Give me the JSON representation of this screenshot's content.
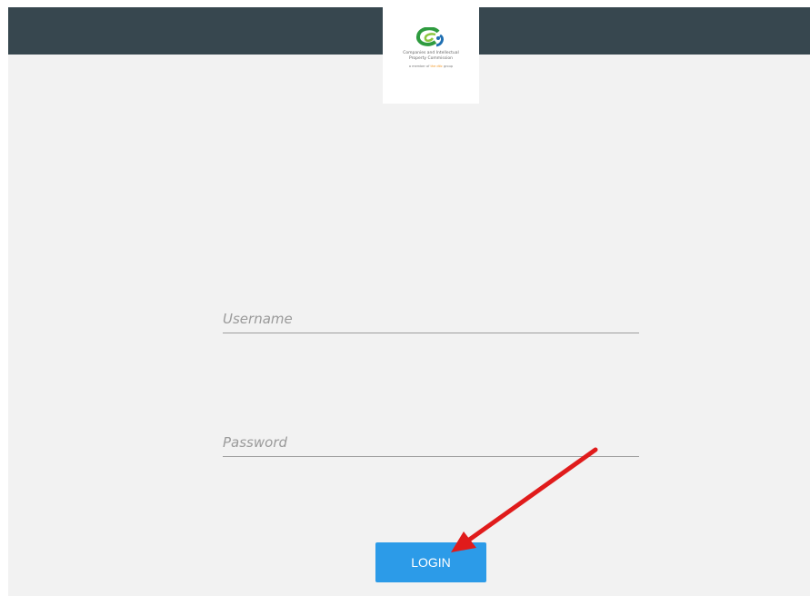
{
  "header": {
    "logo": {
      "icon": "cipc-logo-icon",
      "line_1": "Companies and Intellectual",
      "line_2": "Property Commission",
      "tagline_prefix": "a member of ",
      "tagline_brand": "the dtic",
      "tagline_suffix": " group",
      "brand_colors": [
        "#2e9b3f",
        "#1f6fb2",
        "#f0931d"
      ]
    },
    "bar_color": "#37474f"
  },
  "login_form": {
    "username": {
      "value": "",
      "placeholder": "Username"
    },
    "password": {
      "value": "",
      "placeholder": "Password"
    },
    "login_label": "LOGIN",
    "button_color": "#2c9be8"
  },
  "annotation": {
    "icon": "red-arrow-icon",
    "color": "#e01b1b"
  }
}
